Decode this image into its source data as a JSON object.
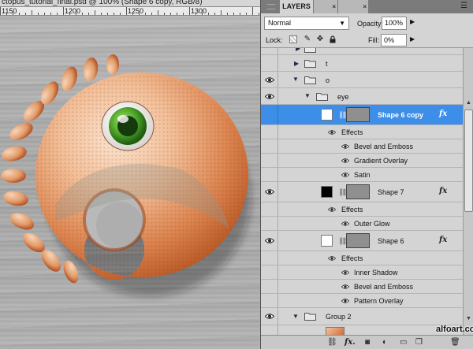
{
  "document": {
    "tab_title": "ctopus_tutorial_final.psd @ 100% (Shape 6 copy, RGB/8)",
    "ruler_labels": [
      "1150",
      "1200",
      "1250",
      "1300"
    ]
  },
  "panel": {
    "tabs": [
      "LAYERS",
      "",
      ""
    ],
    "blend_mode": "Normal",
    "opacity_label": "Opacity:",
    "opacity_value": "100%",
    "lock_label": "Lock:",
    "fill_label": "Fill:",
    "fill_value": "0%"
  },
  "layers": [
    {
      "id": "cut",
      "type": "group",
      "name": "r",
      "visible": false,
      "expanded": false,
      "indent": 1
    },
    {
      "id": "t",
      "type": "group",
      "name": "t",
      "visible": false,
      "expanded": false,
      "indent": 1
    },
    {
      "id": "o",
      "type": "group",
      "name": "o",
      "visible": true,
      "expanded": true,
      "indent": 1
    },
    {
      "id": "eye",
      "type": "group",
      "name": "eye",
      "visible": true,
      "expanded": true,
      "indent": 2
    },
    {
      "id": "shape6copy",
      "type": "layer",
      "name": "Shape 6 copy",
      "selected": true,
      "thumb": "#ffffff",
      "fx": "fx",
      "effects_label": "Effects",
      "effects": [
        "Bevel and Emboss",
        "Gradient Overlay",
        "Satin"
      ]
    },
    {
      "id": "shape7",
      "type": "layer",
      "name": "Shape 7",
      "selected": false,
      "thumb": "#000000",
      "fx": "fx",
      "effects_label": "Effects",
      "effects": [
        "Outer Glow"
      ]
    },
    {
      "id": "shape6",
      "type": "layer",
      "name": "Shape 6",
      "selected": false,
      "thumb": "#ffffff",
      "fx": "fx",
      "effects_label": "Effects",
      "effects": [
        "Inner Shadow",
        "Bevel and Emboss",
        "Pattern Overlay"
      ]
    },
    {
      "id": "group2",
      "type": "group",
      "name": "Group 2",
      "visible": true,
      "expanded": false,
      "indent": 1
    }
  ],
  "watermark": "alfoart.com",
  "colors": {
    "selection": "#3d8ee8",
    "panel_bg": "#d4d4d4",
    "donut_light": "#f7d2b6",
    "donut_dark": "#c8632f",
    "eye_green": "#4faa2a"
  },
  "icons": {
    "footer": [
      "link-icon",
      "fx-icon",
      "mask-icon",
      "adjustment-icon",
      "folder-icon",
      "new-layer-icon",
      "trash-icon"
    ],
    "lock": [
      "lock-transparent-icon",
      "lock-brush-icon",
      "lock-move-icon",
      "lock-all-icon"
    ]
  }
}
